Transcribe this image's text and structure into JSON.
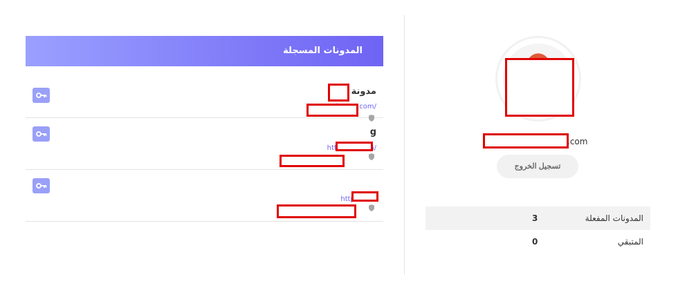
{
  "blogs_panel": {
    "title": "المدونات المسجلة",
    "rows": [
      {
        "title": "مدونة ك",
        "url": "http:/ .com/"
      },
      {
        "title": "g",
        "url": "http: pot.com/"
      },
      {
        "title": "",
        "url": "http .com/"
      }
    ]
  },
  "profile": {
    "email_suffix": ".com",
    "logout_label": "تسجيل الخروج"
  },
  "stats": [
    {
      "label": "المدونات المفعلة",
      "value": "3"
    },
    {
      "label": "المتبقي",
      "value": "0"
    }
  ],
  "colors": {
    "accent": "#6f63f4",
    "accent_light": "#9aa0f8",
    "redaction": "#e00000"
  },
  "icons": {
    "key": "key-icon",
    "shield": "shield-icon"
  }
}
